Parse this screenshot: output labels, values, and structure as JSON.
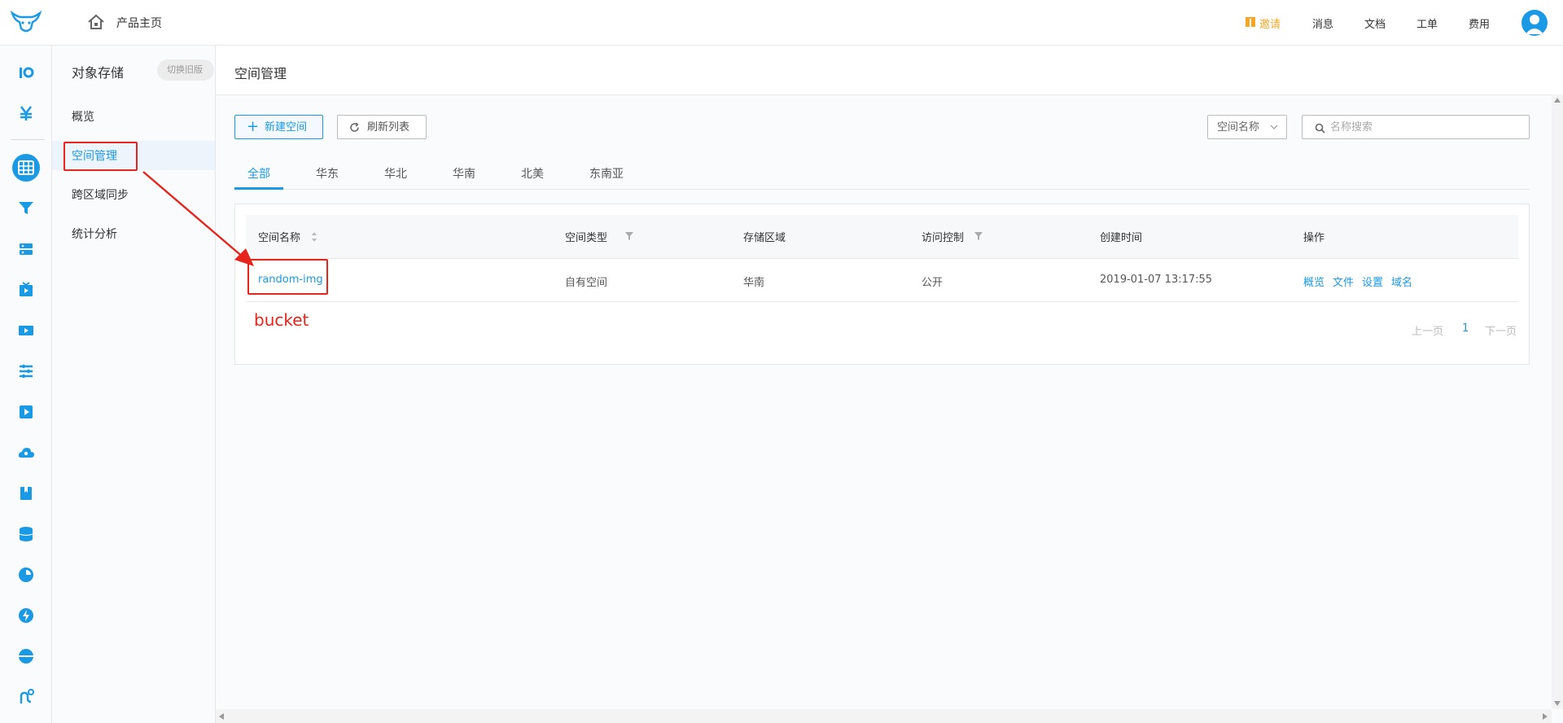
{
  "topbar": {
    "home_label": "产品主页",
    "nav": {
      "invite": "邀请",
      "messages": "消息",
      "docs": "文档",
      "tickets": "工单",
      "billing": "费用"
    },
    "invite_color": "#f5a623"
  },
  "sidebar": {
    "title": "对象存储",
    "switch_label": "切换旧版",
    "items": [
      {
        "label": "概览"
      },
      {
        "label": "空间管理",
        "active": true
      },
      {
        "label": "跨区域同步"
      },
      {
        "label": "统计分析"
      }
    ]
  },
  "page": {
    "title": "空间管理",
    "new_button": "新建空间",
    "refresh_button": "刷新列表",
    "filter_select": "空间名称",
    "search_placeholder": "名称搜索",
    "tabs": [
      {
        "label": "全部",
        "active": true
      },
      {
        "label": "华东"
      },
      {
        "label": "华北"
      },
      {
        "label": "华南"
      },
      {
        "label": "北美"
      },
      {
        "label": "东南亚"
      }
    ]
  },
  "table": {
    "headers": [
      "空间名称",
      "空间类型",
      "存储区域",
      "访问控制",
      "创建时间",
      "操作"
    ],
    "rows": [
      {
        "name": "random-img",
        "type": "自有空间",
        "region": "华南",
        "access": "公开",
        "created": "2019-01-07 13:17:55",
        "actions": [
          "概览",
          "文件",
          "设置",
          "域名"
        ]
      }
    ]
  },
  "pager": {
    "prev": "上一页",
    "current": "1",
    "next": "下一页"
  },
  "annotation": {
    "label": "bucket",
    "color": "#e6251d"
  },
  "accent_color": "#1a9ae5"
}
